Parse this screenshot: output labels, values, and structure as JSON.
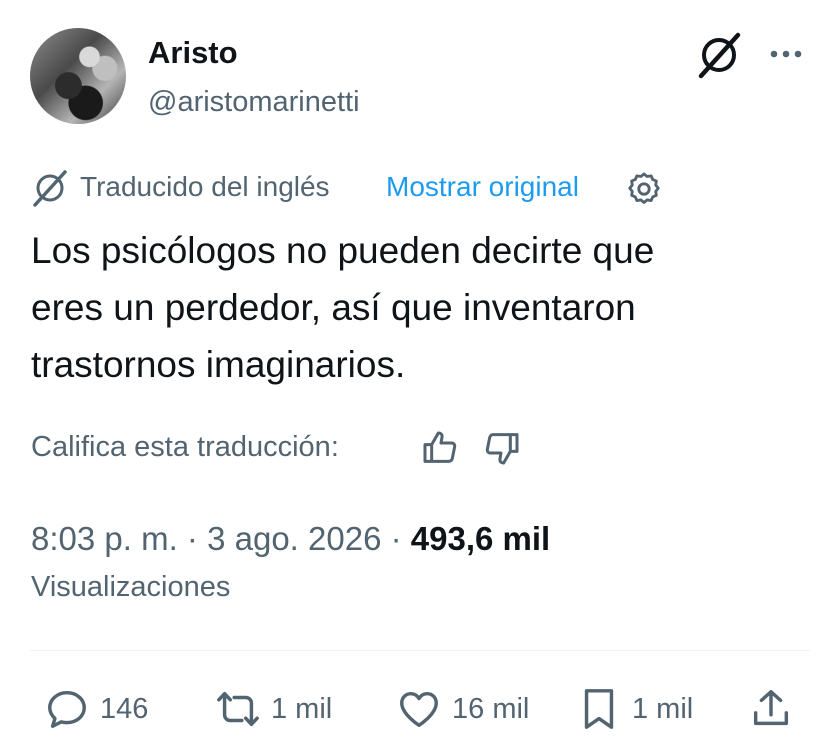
{
  "author": {
    "display_name": "Aristo",
    "handle": "@aristomarinetti"
  },
  "translation": {
    "label": "Traducido del inglés",
    "show_original": "Mostrar original"
  },
  "tweet": {
    "text": "Los psicólogos no pueden decirte que\neres un perdedor, así que inventaron\ntrastornos imaginarios."
  },
  "rate": {
    "label": "Califica esta traducción:"
  },
  "meta": {
    "time": "8:03 p. m.",
    "separator": "·",
    "date": "3 ago. 2026",
    "views_count": "493,6 mil",
    "views_label": "Visualizaciones"
  },
  "actions": {
    "replies": "146",
    "reposts": "1 mil",
    "likes": "16 mil",
    "bookmarks": "1 mil"
  },
  "colors": {
    "text": "#0f1419",
    "secondary": "#536471",
    "link": "#1d9bf0",
    "divider": "#eff3f4"
  },
  "icons": [
    "avatar",
    "grok-icon",
    "more-icon",
    "translate-icon",
    "gear-icon",
    "thumb-up-icon",
    "thumb-down-icon",
    "reply-icon",
    "repost-icon",
    "like-icon",
    "bookmark-icon",
    "share-icon"
  ]
}
